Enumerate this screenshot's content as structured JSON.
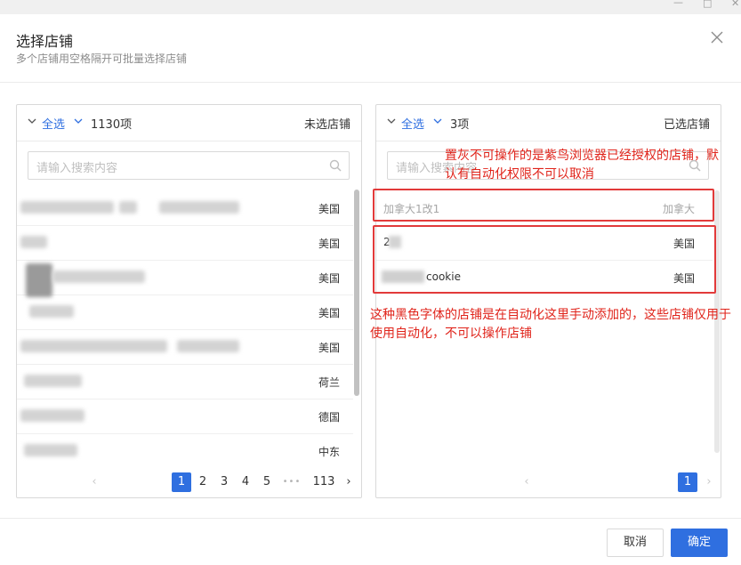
{
  "dialog": {
    "title": "选择店铺",
    "subtitle": "多个店铺用空格隔开可批量选择店铺",
    "cancel_label": "取消",
    "confirm_label": "确定"
  },
  "left_panel": {
    "select_all": "全选",
    "count": "1130项",
    "title": "未选店铺",
    "search_placeholder": "请输入搜索内容",
    "rows": [
      {
        "country": "美国"
      },
      {
        "country": "美国"
      },
      {
        "country": "美国"
      },
      {
        "country": "美国"
      },
      {
        "country": "美国"
      },
      {
        "country": "荷兰"
      },
      {
        "country": "德国"
      },
      {
        "country": "中东"
      }
    ],
    "pagination": {
      "pages": [
        "1",
        "2",
        "3",
        "4",
        "5"
      ],
      "ellipsis": "•••",
      "last": "113",
      "current": "1"
    }
  },
  "right_panel": {
    "select_all": "全选",
    "count": "3项",
    "title": "已选店铺",
    "search_placeholder": "请输入搜索内容",
    "rows": [
      {
        "name": "加拿大1改1",
        "country": "加拿大",
        "disabled": true
      },
      {
        "name": "2",
        "country": "美国",
        "disabled": false
      },
      {
        "name": "cookie",
        "country": "美国",
        "disabled": false
      }
    ],
    "pagination": {
      "current": "1"
    }
  },
  "annotations": {
    "top": "置灰不可操作的是紫鸟浏览器已经授权的店铺，默认有自动化权限不可以取消",
    "bottom": "这种黑色字体的店铺是在自动化这里手动添加的，这些店铺仅用于使用自动化，不可以操作店铺"
  },
  "colors": {
    "accent": "#2f6fe0",
    "annotation_red": "#e0241b",
    "disabled_text": "#a6a6a6"
  }
}
